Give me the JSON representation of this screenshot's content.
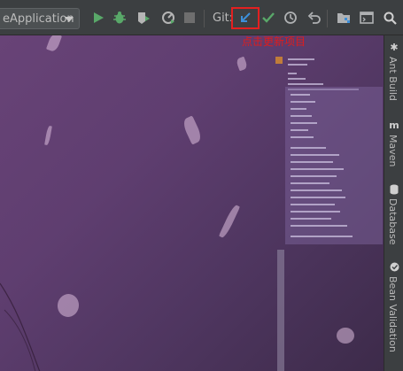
{
  "toolbar": {
    "run_config": "eApplication",
    "git_label": "Git:",
    "icons": [
      "run-icon",
      "debug-icon",
      "coverage-icon",
      "profile-icon",
      "stop-icon",
      "git-update-icon",
      "git-commit-icon",
      "git-history-icon",
      "git-rollback-icon",
      "project-structure-icon",
      "terminal-icon",
      "search-icon"
    ]
  },
  "annotation": "点击更新项目",
  "right_panel": {
    "tabs": [
      "Ant Build",
      "Maven",
      "Database",
      "Bean Validation"
    ]
  }
}
